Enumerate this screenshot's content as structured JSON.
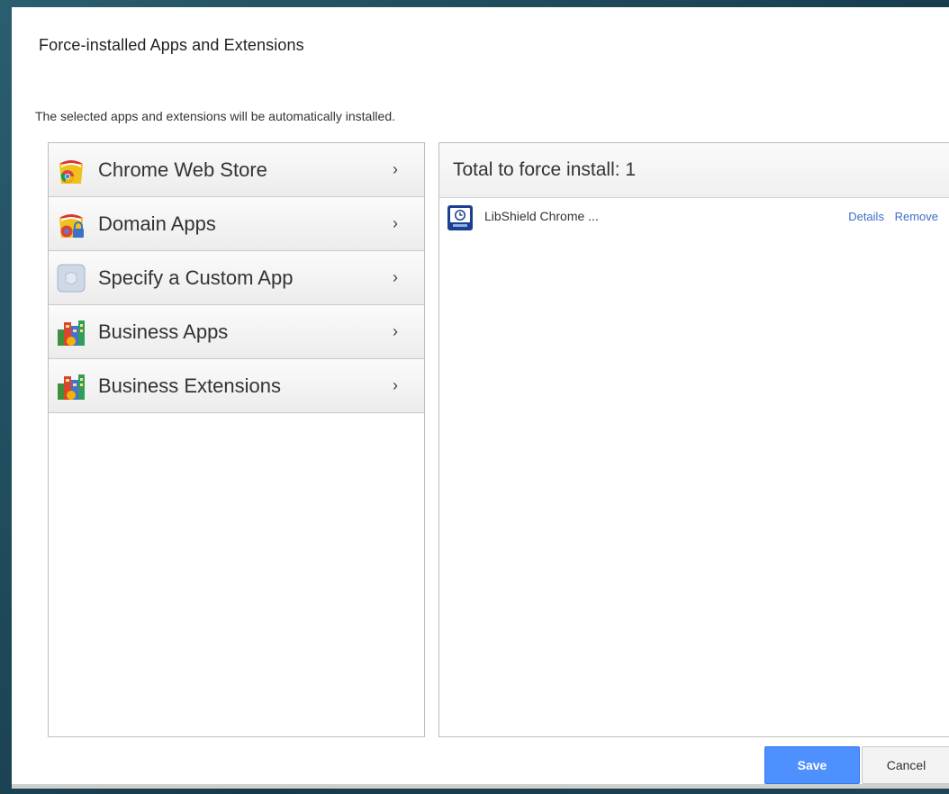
{
  "dialog": {
    "title": "Force-installed Apps and Extensions",
    "description": "The selected apps and extensions will be automatically installed."
  },
  "categories": [
    {
      "label": "Chrome Web Store",
      "icon": "chrome-web-store-icon"
    },
    {
      "label": "Domain Apps",
      "icon": "domain-apps-icon"
    },
    {
      "label": "Specify a Custom App",
      "icon": "custom-app-icon"
    },
    {
      "label": "Business Apps",
      "icon": "business-apps-icon"
    },
    {
      "label": "Business Extensions",
      "icon": "business-extensions-icon"
    }
  ],
  "chevron": "›",
  "installed": {
    "header": "Total to force install: 1",
    "items": [
      {
        "name": "LibShield Chrome ...",
        "icon": "libshield-icon",
        "details_label": "Details",
        "remove_label": "Remove"
      }
    ]
  },
  "buttons": {
    "save_label": "Save",
    "cancel_label": "Cancel"
  },
  "colors": {
    "accent": "#4d90fe",
    "link": "#3b6fc8"
  }
}
